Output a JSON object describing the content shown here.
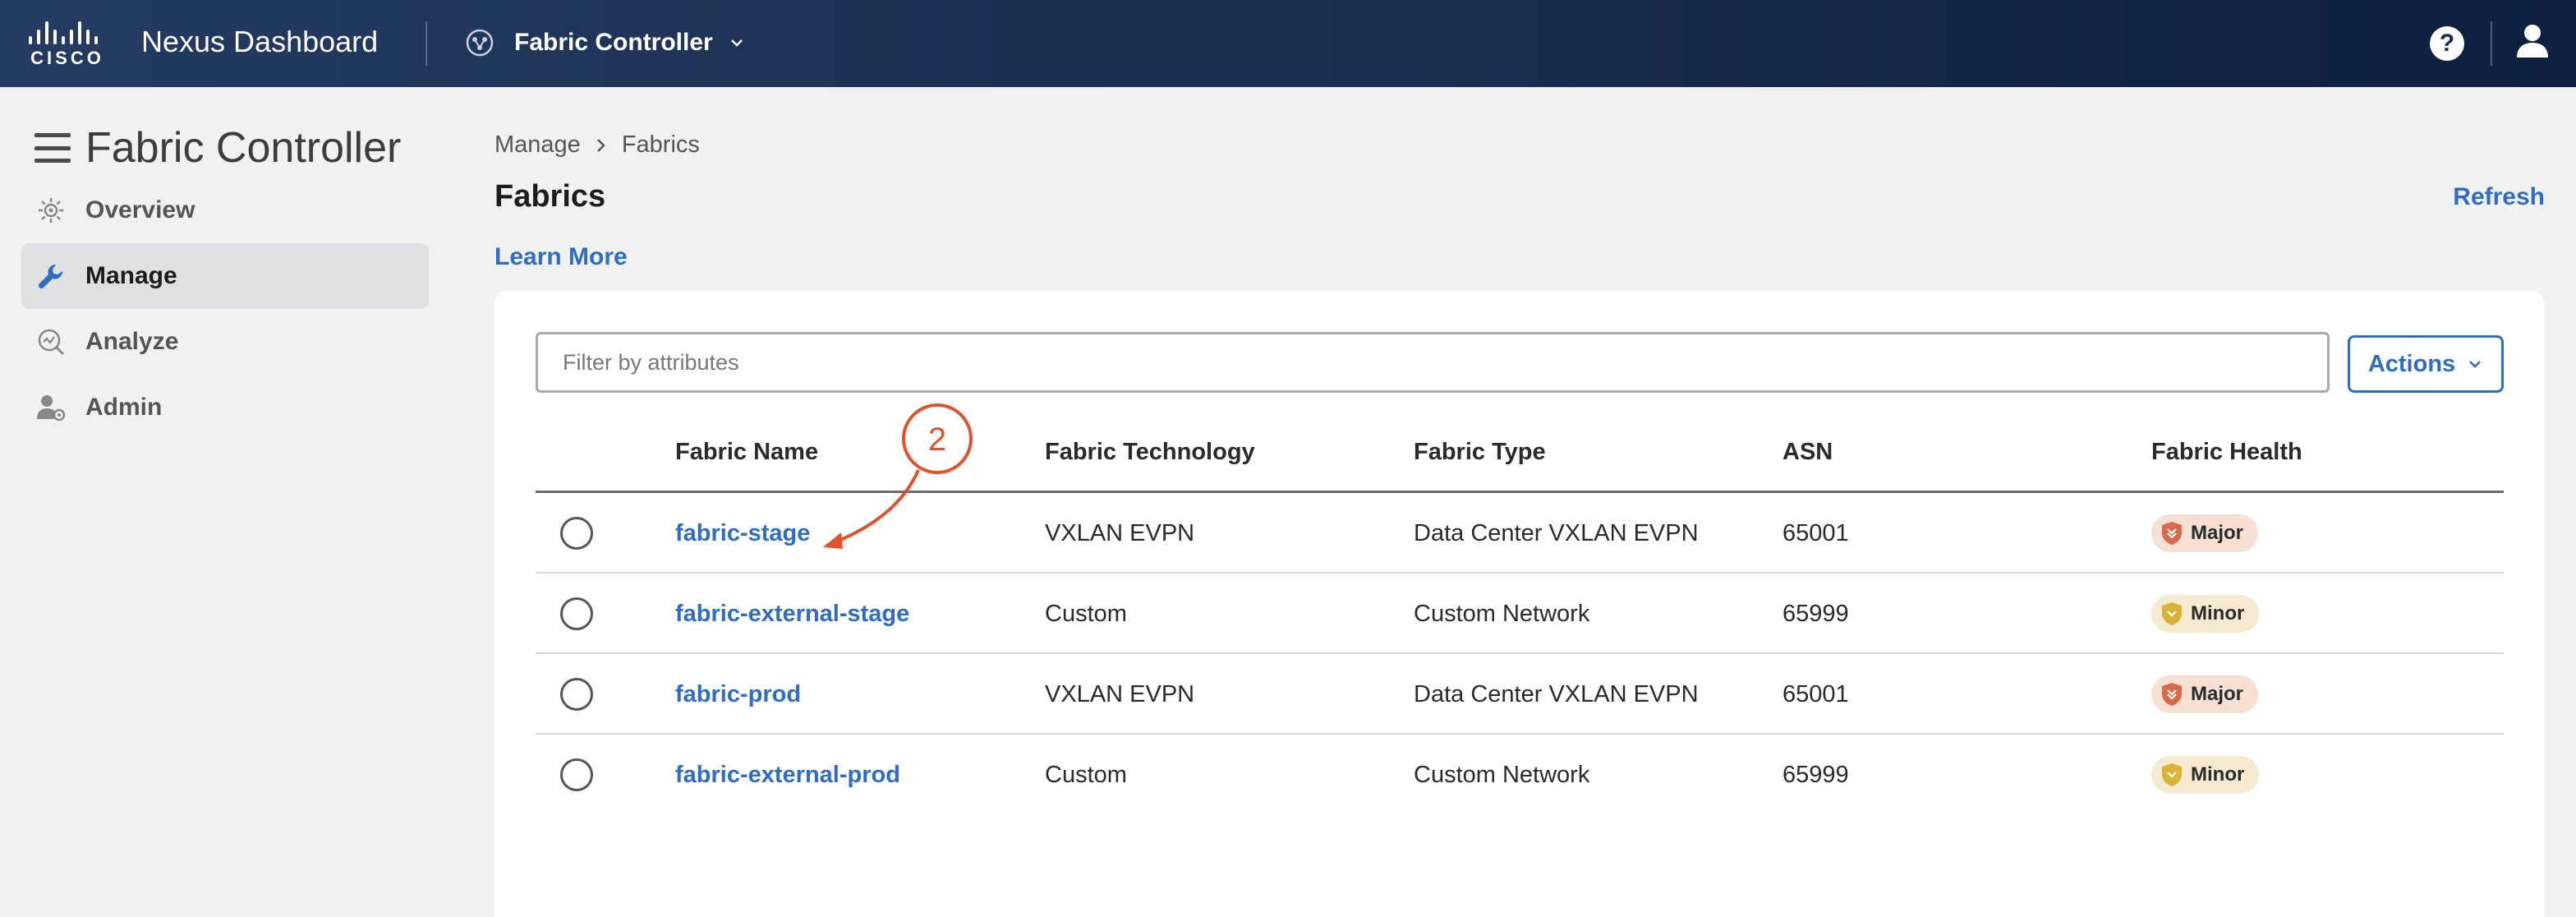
{
  "header": {
    "brand_word": "CISCO",
    "product_name": "Nexus Dashboard",
    "app_switcher_label": "Fabric Controller",
    "help_glyph": "?"
  },
  "sidebar": {
    "title": "Fabric Controller",
    "items": [
      {
        "label": "Overview",
        "icon": "overview-icon",
        "active": false
      },
      {
        "label": "Manage",
        "icon": "wrench-icon",
        "active": true
      },
      {
        "label": "Analyze",
        "icon": "analyze-icon",
        "active": false
      },
      {
        "label": "Admin",
        "icon": "admin-icon",
        "active": false
      }
    ]
  },
  "main": {
    "breadcrumb": [
      "Manage",
      "Fabrics"
    ],
    "title": "Fabrics",
    "refresh_label": "Refresh",
    "learn_more_label": "Learn More",
    "filter_placeholder": "Filter by attributes",
    "actions_label": "Actions",
    "columns": [
      "Fabric Name",
      "Fabric Technology",
      "Fabric Type",
      "ASN",
      "Fabric Health"
    ],
    "rows": [
      {
        "name": "fabric-stage",
        "technology": "VXLAN EVPN",
        "type": "Data Center VXLAN EVPN",
        "asn": "65001",
        "health": "Major"
      },
      {
        "name": "fabric-external-stage",
        "technology": "Custom",
        "type": "Custom Network",
        "asn": "65999",
        "health": "Minor"
      },
      {
        "name": "fabric-prod",
        "technology": "VXLAN EVPN",
        "type": "Data Center VXLAN EVPN",
        "asn": "65001",
        "health": "Major"
      },
      {
        "name": "fabric-external-prod",
        "technology": "Custom",
        "type": "Custom Network",
        "asn": "65999",
        "health": "Minor"
      }
    ]
  },
  "annotation": {
    "step_number": "2",
    "color": "#e0522e"
  },
  "colors": {
    "link": "#2f6cc3",
    "topbar": "#1a2c4f",
    "major_shield": "#d9694a",
    "minor_shield": "#d9b23a"
  }
}
